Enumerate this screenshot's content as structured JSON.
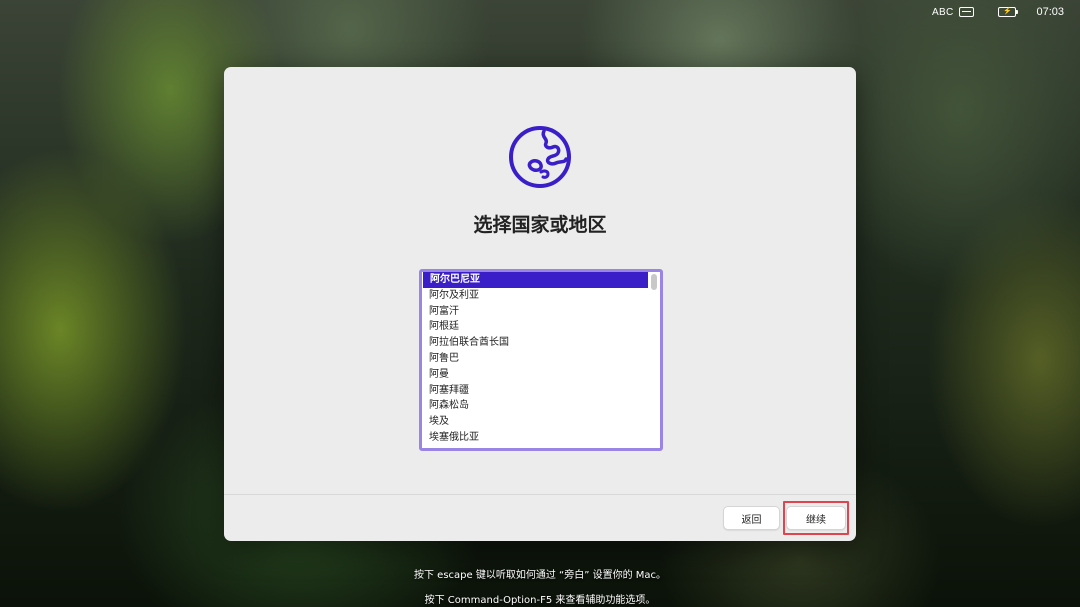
{
  "menubar": {
    "input_source": "ABC",
    "clock": "07:03",
    "icons": [
      "keyboard-icon",
      "battery-charging-icon"
    ]
  },
  "setup": {
    "title": "选择国家或地区",
    "icon": "globe-icon",
    "accent_color": "#3a1fc9",
    "countries": [
      "阿尔巴尼亚",
      "阿尔及利亚",
      "阿富汗",
      "阿根廷",
      "阿拉伯联合酋长国",
      "阿鲁巴",
      "阿曼",
      "阿塞拜疆",
      "阿森松岛",
      "埃及",
      "埃塞俄比亚"
    ],
    "selected_country": "阿尔巴尼亚",
    "back_label": "返回",
    "continue_label": "继续"
  },
  "hints": {
    "line1": "按下 escape 键以听取如何通过 “旁白” 设置你的 Mac。",
    "line2": "按下 Command-Option-F5 来查看辅助功能选项。"
  }
}
